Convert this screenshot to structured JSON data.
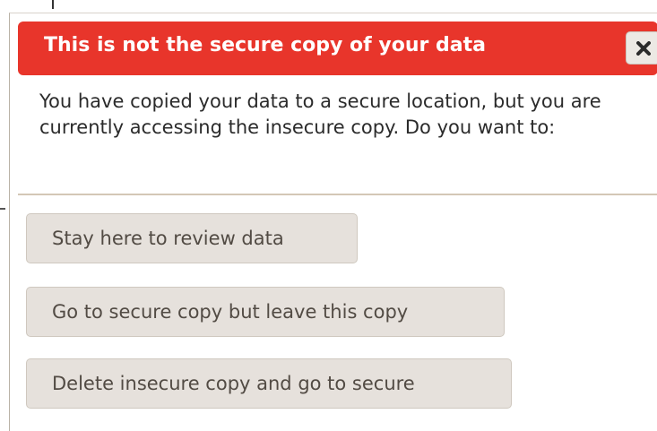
{
  "dialog": {
    "title": "This is not the secure copy of your data",
    "close_icon": "close-icon",
    "message": "You have copied your data to a secure location, but you are currently accessing the insecure copy. Do you want to:",
    "actions": [
      {
        "label": "Stay here to review data"
      },
      {
        "label": "Go to secure copy but leave this copy"
      },
      {
        "label": "Delete insecure copy and go to secure"
      }
    ]
  },
  "colors": {
    "titlebar": "#e8352b",
    "button_bg": "#e6e1dc",
    "button_text": "#524b44",
    "divider": "#d3c7b6"
  }
}
